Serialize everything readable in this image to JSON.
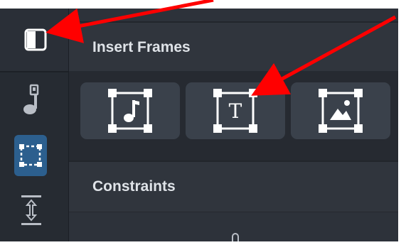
{
  "sections": {
    "insert_frames": {
      "title": "Insert Frames"
    },
    "constraints": {
      "title": "Constraints"
    }
  },
  "rail": {
    "items": [
      {
        "icon": "panel-toggle-icon"
      },
      {
        "icon": "music-note-icon"
      },
      {
        "icon": "frame-select-icon",
        "active": true
      },
      {
        "icon": "vertical-distribute-icon"
      }
    ]
  },
  "frame_buttons": [
    {
      "icon": "audio-frame-icon"
    },
    {
      "icon": "text-frame-icon",
      "glyph": "T"
    },
    {
      "icon": "image-frame-icon"
    }
  ],
  "colors": {
    "accent": "#2c5f8e",
    "annotation_arrow": "#ff0000",
    "background": "#2d323a"
  }
}
